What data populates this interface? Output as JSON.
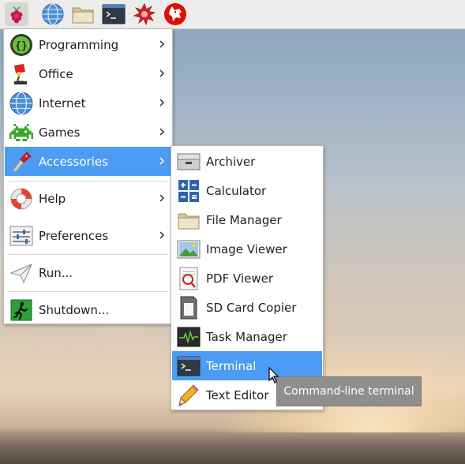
{
  "taskbar": {
    "buttons": [
      {
        "name": "raspberry-menu",
        "icon": "raspberry-icon"
      },
      {
        "name": "web-browser",
        "icon": "globe-icon"
      },
      {
        "name": "file-manager",
        "icon": "folder-icon"
      },
      {
        "name": "terminal",
        "icon": "terminal-icon"
      },
      {
        "name": "mathematica",
        "icon": "star-burst-icon"
      },
      {
        "name": "wolfram",
        "icon": "wolf-icon"
      }
    ]
  },
  "main_menu": {
    "items": [
      {
        "label": "Programming",
        "icon": "braces-icon",
        "has_submenu": true
      },
      {
        "label": "Office",
        "icon": "lamp-icon",
        "has_submenu": true
      },
      {
        "label": "Internet",
        "icon": "globe-icon",
        "has_submenu": true
      },
      {
        "label": "Games",
        "icon": "space-invader-icon",
        "has_submenu": true
      },
      {
        "label": "Accessories",
        "icon": "pocket-knife-icon",
        "has_submenu": true,
        "active": true
      },
      {
        "label": "Help",
        "icon": "lifebuoy-icon",
        "has_submenu": true
      },
      {
        "label": "Preferences",
        "icon": "sliders-icon",
        "has_submenu": true
      },
      {
        "label": "Run...",
        "icon": "paper-plane-icon",
        "has_submenu": false
      },
      {
        "label": "Shutdown...",
        "icon": "exit-icon",
        "has_submenu": false
      }
    ]
  },
  "sub_menu": {
    "items": [
      {
        "label": "Archiver",
        "icon": "archive-icon"
      },
      {
        "label": "Calculator",
        "icon": "calculator-icon"
      },
      {
        "label": "File Manager",
        "icon": "folder-icon"
      },
      {
        "label": "Image Viewer",
        "icon": "image-icon"
      },
      {
        "label": "PDF Viewer",
        "icon": "pdf-icon"
      },
      {
        "label": "SD Card Copier",
        "icon": "sd-card-icon"
      },
      {
        "label": "Task Manager",
        "icon": "monitor-icon"
      },
      {
        "label": "Terminal",
        "icon": "terminal-icon",
        "active": true
      },
      {
        "label": "Text Editor",
        "icon": "pencil-icon"
      }
    ]
  },
  "tooltip": {
    "text": "Command-line terminal"
  },
  "colors": {
    "highlight": "#4b9cf2",
    "taskbar": "#edecea",
    "menu_bg": "#ffffff"
  }
}
